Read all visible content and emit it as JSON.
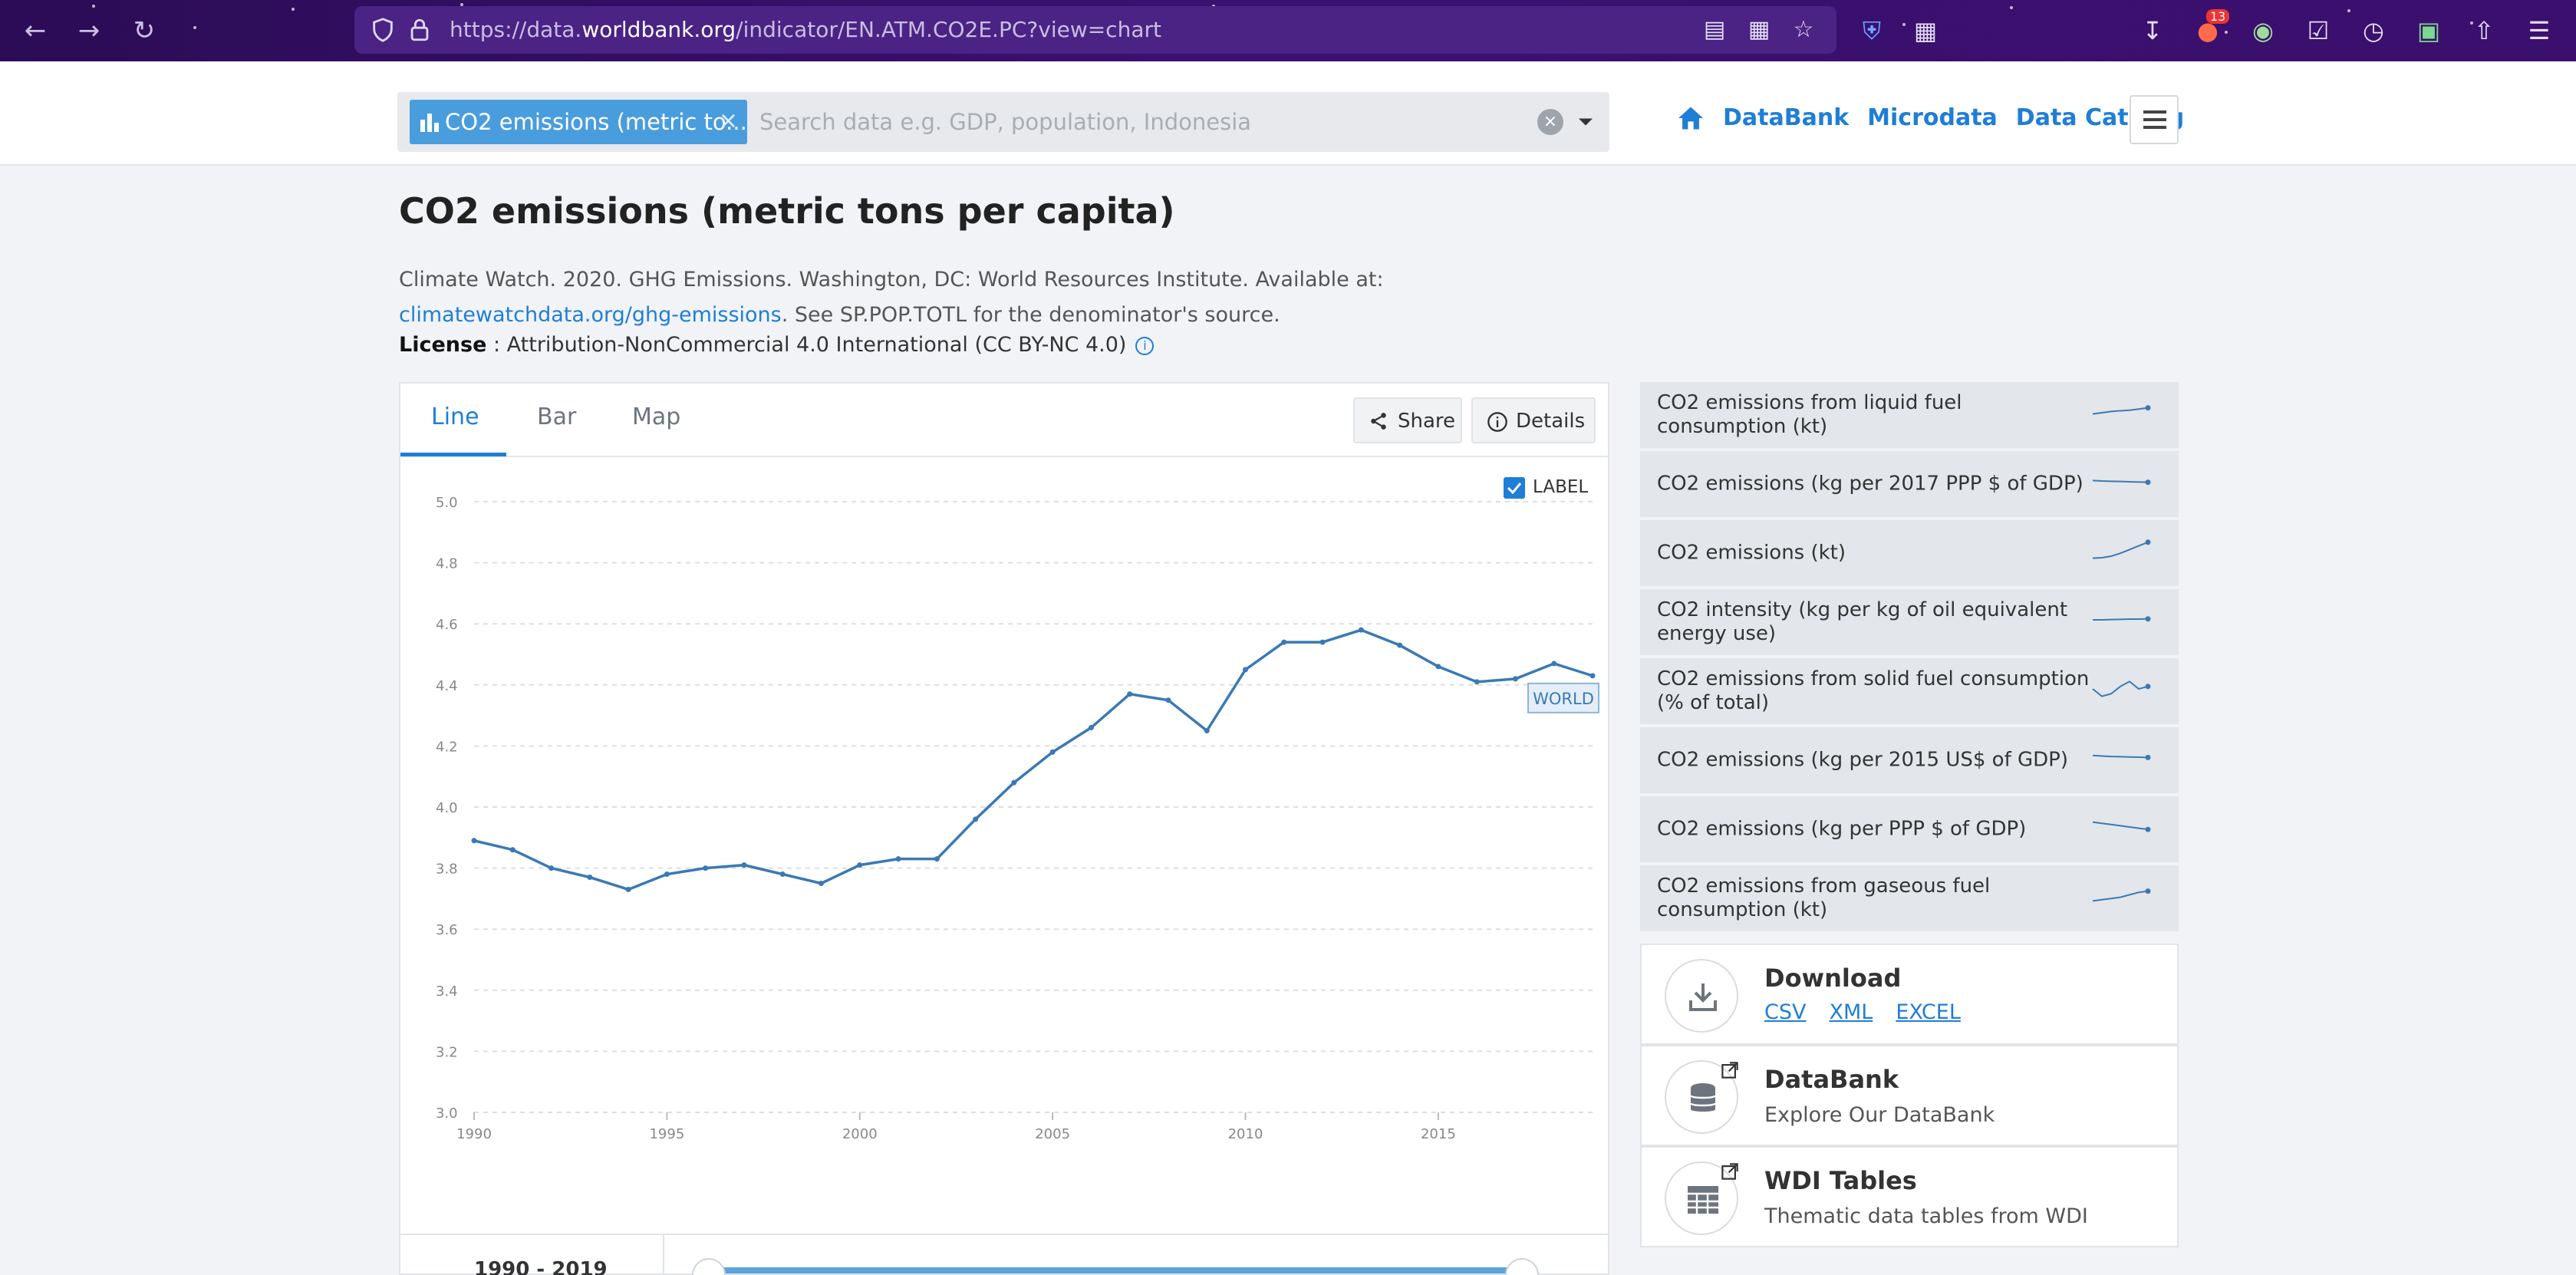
{
  "browser": {
    "url_prefix": "https://data.",
    "url_domain": "worldbank.org",
    "url_path": "/indicator/EN.ATM.CO2E.PC?view=chart",
    "notification_badge": "13"
  },
  "header": {
    "search_chip": "CO2 emissions (metric to...",
    "search_placeholder": "Search data e.g. GDP, population, Indonesia",
    "nav": [
      "DataBank",
      "Microdata",
      "Data Catalog"
    ]
  },
  "page": {
    "title": "CO2 emissions (metric tons per capita)",
    "source_text": "Climate Watch. 2020. GHG Emissions. Washington, DC: World Resources Institute. Available at: ",
    "source_link": "climatewatchdata.org/ghg-emissions",
    "source_text_after": ". See SP.POP.TOTL for the denominator's source.",
    "license_label": "License",
    "license_sep": " : ",
    "license_value": "Attribution-NonCommercial 4.0 International (CC BY-NC 4.0)"
  },
  "chart_panel": {
    "tabs": [
      "Line",
      "Bar",
      "Map"
    ],
    "active_tab": "Line",
    "share_label": "Share",
    "details_label": "Details",
    "label_toggle": "LABEL",
    "label_checked": true,
    "range_text": "1990 - 2019"
  },
  "chart_data": {
    "type": "line",
    "title": "",
    "xlabel": "",
    "ylabel": "",
    "x_ticks": [
      1990,
      1995,
      2000,
      2005,
      2010,
      2015
    ],
    "y_ticks": [
      3.0,
      3.2,
      3.4,
      3.6,
      3.8,
      4.0,
      4.2,
      4.4,
      4.6,
      4.8,
      5.0
    ],
    "xlim": [
      1990,
      2019
    ],
    "ylim": [
      3.0,
      5.0
    ],
    "grid": true,
    "series": [
      {
        "name": "WORLD",
        "color": "#3b79b5",
        "x": [
          1990,
          1991,
          1992,
          1993,
          1994,
          1995,
          1996,
          1997,
          1998,
          1999,
          2000,
          2001,
          2002,
          2003,
          2004,
          2005,
          2006,
          2007,
          2008,
          2009,
          2010,
          2011,
          2012,
          2013,
          2014,
          2015,
          2016,
          2017,
          2018,
          2019
        ],
        "values": [
          3.89,
          3.86,
          3.8,
          3.77,
          3.73,
          3.78,
          3.8,
          3.81,
          3.78,
          3.75,
          3.81,
          3.83,
          3.83,
          3.96,
          4.08,
          4.18,
          4.26,
          4.37,
          4.35,
          4.25,
          4.45,
          4.54,
          4.54,
          4.58,
          4.53,
          4.46,
          4.41,
          4.42,
          4.47,
          4.43
        ]
      }
    ]
  },
  "related": [
    {
      "label": "CO2 emissions from liquid fuel consumption (kt)",
      "trend": [
        0.55,
        0.5,
        0.45,
        0.42,
        0.4,
        0.35,
        0.3
      ]
    },
    {
      "label": "CO2 emissions (kg per 2017 PPP $ of GDP)",
      "trend": [
        0.45,
        0.47,
        0.48,
        0.49,
        0.5,
        0.51,
        0.52
      ]
    },
    {
      "label": "CO2 emissions (kt)",
      "trend": [
        0.8,
        0.78,
        0.72,
        0.6,
        0.45,
        0.3,
        0.15
      ]
    },
    {
      "label": "CO2 intensity (kg per kg of oil equivalent energy use)",
      "trend": [
        0.5,
        0.5,
        0.49,
        0.48,
        0.47,
        0.47,
        0.46
      ]
    },
    {
      "label": "CO2 emissions from solid fuel consumption (% of total)",
      "trend": [
        0.5,
        0.8,
        0.7,
        0.4,
        0.2,
        0.5,
        0.4
      ]
    },
    {
      "label": "CO2 emissions (kg per 2015 US$ of GDP)",
      "trend": [
        0.4,
        0.42,
        0.44,
        0.45,
        0.46,
        0.47,
        0.48
      ]
    },
    {
      "label": "CO2 emissions (kg per PPP $ of GDP)",
      "trend": [
        0.3,
        0.35,
        0.4,
        0.45,
        0.5,
        0.55,
        0.6
      ]
    },
    {
      "label": "CO2 emissions from gaseous fuel consumption (kt)",
      "trend": [
        0.7,
        0.65,
        0.6,
        0.55,
        0.45,
        0.35,
        0.3
      ]
    }
  ],
  "resources": {
    "download": {
      "title": "Download",
      "links": [
        "CSV",
        "XML",
        "EXCEL"
      ]
    },
    "databank": {
      "title": "DataBank",
      "subtitle": "Explore Our DataBank"
    },
    "wdi": {
      "title": "WDI Tables",
      "subtitle": "Thematic data tables from WDI"
    }
  },
  "colors": {
    "accent": "#1f7ed6",
    "chip": "#4a9ddd",
    "line": "#3b79b5",
    "browser": "#3a1070"
  }
}
